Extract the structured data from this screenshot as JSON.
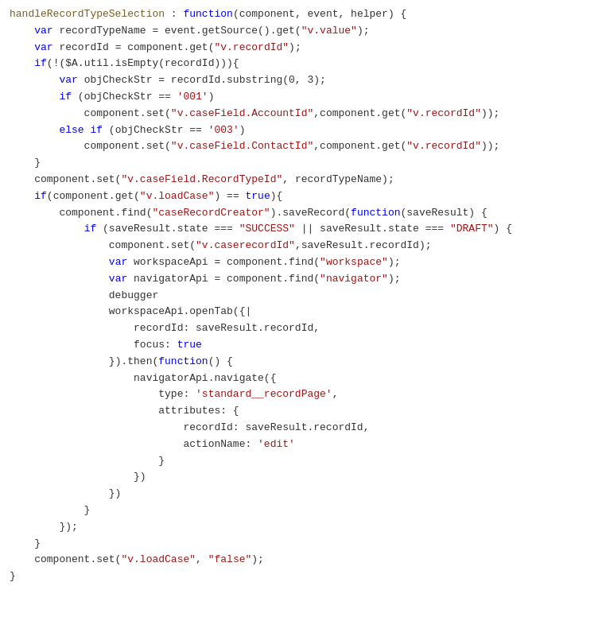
{
  "code": {
    "lines": [
      {
        "indent": 0,
        "tokens": [
          {
            "text": "handleRecordTypeSelection",
            "class": "c-fn-name"
          },
          {
            "text": " : ",
            "class": "c-default"
          },
          {
            "text": "function",
            "class": "c-keyword"
          },
          {
            "text": "(component, event, helper) {",
            "class": "c-default"
          }
        ]
      },
      {
        "indent": 1,
        "tokens": [
          {
            "text": "    ",
            "class": "c-default"
          },
          {
            "text": "var",
            "class": "c-keyword"
          },
          {
            "text": " recordTypeName = event.getSource().get(",
            "class": "c-default"
          },
          {
            "text": "\"v.value\"",
            "class": "c-string"
          },
          {
            "text": ");",
            "class": "c-default"
          }
        ]
      },
      {
        "indent": 1,
        "tokens": [
          {
            "text": "    ",
            "class": "c-default"
          },
          {
            "text": "var",
            "class": "c-keyword"
          },
          {
            "text": " recordId = component.get(",
            "class": "c-default"
          },
          {
            "text": "\"v.recordId\"",
            "class": "c-string"
          },
          {
            "text": ");",
            "class": "c-default"
          }
        ]
      },
      {
        "indent": 1,
        "tokens": [
          {
            "text": "    ",
            "class": "c-default"
          },
          {
            "text": "if",
            "class": "c-keyword"
          },
          {
            "text": "(!($A.util.isEmpty(recordId))){",
            "class": "c-default"
          }
        ]
      },
      {
        "indent": 2,
        "tokens": [
          {
            "text": "        ",
            "class": "c-default"
          },
          {
            "text": "var",
            "class": "c-keyword"
          },
          {
            "text": " objCheckStr = recordId.substring(0, 3);",
            "class": "c-default"
          }
        ]
      },
      {
        "indent": 2,
        "tokens": [
          {
            "text": "        ",
            "class": "c-default"
          },
          {
            "text": "if",
            "class": "c-keyword"
          },
          {
            "text": " (objCheckStr == ",
            "class": "c-default"
          },
          {
            "text": "'001'",
            "class": "c-string"
          },
          {
            "text": ")",
            "class": "c-default"
          }
        ]
      },
      {
        "indent": 3,
        "tokens": [
          {
            "text": "            component.set(",
            "class": "c-default"
          },
          {
            "text": "\"v.caseField.AccountId\"",
            "class": "c-string"
          },
          {
            "text": ",component.get(",
            "class": "c-default"
          },
          {
            "text": "\"v.recordId\"",
            "class": "c-string"
          },
          {
            "text": "));",
            "class": "c-default"
          }
        ]
      },
      {
        "indent": 2,
        "tokens": [
          {
            "text": "        ",
            "class": "c-default"
          },
          {
            "text": "else",
            "class": "c-keyword"
          },
          {
            "text": " ",
            "class": "c-default"
          },
          {
            "text": "if",
            "class": "c-keyword"
          },
          {
            "text": " (objCheckStr == ",
            "class": "c-default"
          },
          {
            "text": "'003'",
            "class": "c-string"
          },
          {
            "text": ")",
            "class": "c-default"
          }
        ]
      },
      {
        "indent": 3,
        "tokens": [
          {
            "text": "            component.set(",
            "class": "c-default"
          },
          {
            "text": "\"v.caseField.ContactId\"",
            "class": "c-string"
          },
          {
            "text": ",component.get(",
            "class": "c-default"
          },
          {
            "text": "\"v.recordId\"",
            "class": "c-string"
          },
          {
            "text": "));",
            "class": "c-default"
          }
        ]
      },
      {
        "indent": 1,
        "tokens": [
          {
            "text": "    }",
            "class": "c-default"
          }
        ]
      },
      {
        "indent": 1,
        "tokens": [
          {
            "text": "    component.set(",
            "class": "c-default"
          },
          {
            "text": "\"v.caseField.RecordTypeId\"",
            "class": "c-string"
          },
          {
            "text": ", recordTypeName);",
            "class": "c-default"
          }
        ]
      },
      {
        "indent": 1,
        "tokens": [
          {
            "text": "    ",
            "class": "c-default"
          },
          {
            "text": "if",
            "class": "c-keyword"
          },
          {
            "text": "(component.get(",
            "class": "c-default"
          },
          {
            "text": "\"v.loadCase\"",
            "class": "c-string"
          },
          {
            "text": ") == ",
            "class": "c-default"
          },
          {
            "text": "true",
            "class": "c-keyword"
          },
          {
            "text": "){",
            "class": "c-default"
          }
        ]
      },
      {
        "indent": 2,
        "tokens": [
          {
            "text": "        component.find(",
            "class": "c-default"
          },
          {
            "text": "\"caseRecordCreator\"",
            "class": "c-string"
          },
          {
            "text": ").saveRecord(",
            "class": "c-default"
          },
          {
            "text": "function",
            "class": "c-keyword"
          },
          {
            "text": "(saveResult) {",
            "class": "c-default"
          }
        ]
      },
      {
        "indent": 3,
        "tokens": [
          {
            "text": "            ",
            "class": "c-default"
          },
          {
            "text": "if",
            "class": "c-keyword"
          },
          {
            "text": " (saveResult.state === ",
            "class": "c-default"
          },
          {
            "text": "\"SUCCESS\"",
            "class": "c-string"
          },
          {
            "text": " || saveResult.state === ",
            "class": "c-default"
          },
          {
            "text": "\"DRAFT\"",
            "class": "c-string"
          },
          {
            "text": ") {",
            "class": "c-default"
          }
        ]
      },
      {
        "indent": 4,
        "tokens": [
          {
            "text": "                component.set(",
            "class": "c-default"
          },
          {
            "text": "\"v.caserecordId\"",
            "class": "c-string"
          },
          {
            "text": ",saveResult.recordId);",
            "class": "c-default"
          }
        ]
      },
      {
        "indent": 4,
        "tokens": [
          {
            "text": "                ",
            "class": "c-default"
          },
          {
            "text": "var",
            "class": "c-keyword"
          },
          {
            "text": " workspaceApi = component.find(",
            "class": "c-default"
          },
          {
            "text": "\"workspace\"",
            "class": "c-string"
          },
          {
            "text": ");",
            "class": "c-default"
          }
        ]
      },
      {
        "indent": 4,
        "tokens": [
          {
            "text": "                ",
            "class": "c-default"
          },
          {
            "text": "var",
            "class": "c-keyword"
          },
          {
            "text": " navigatorApi = component.find(",
            "class": "c-default"
          },
          {
            "text": "\"navigator\"",
            "class": "c-string"
          },
          {
            "text": ");",
            "class": "c-default"
          }
        ]
      },
      {
        "indent": 4,
        "tokens": [
          {
            "text": "                debugger",
            "class": "c-default"
          }
        ]
      },
      {
        "indent": 4,
        "tokens": [
          {
            "text": "                workspaceApi.openTab({",
            "class": "c-default"
          },
          {
            "text": "|",
            "class": "c-default"
          }
        ]
      },
      {
        "indent": 5,
        "tokens": [
          {
            "text": "                    recordId: saveResult.recordId,",
            "class": "c-default"
          }
        ]
      },
      {
        "indent": 5,
        "tokens": [
          {
            "text": "                    focus: ",
            "class": "c-default"
          },
          {
            "text": "true",
            "class": "c-keyword"
          }
        ]
      },
      {
        "indent": 4,
        "tokens": [
          {
            "text": "                ",
            "class": "c-default"
          },
          {
            "text": "}).then(",
            "class": "c-default"
          },
          {
            "text": "function",
            "class": "c-keyword"
          },
          {
            "text": "() {",
            "class": "c-default"
          }
        ]
      },
      {
        "indent": 5,
        "tokens": [
          {
            "text": "                    navigatorApi.navigate({",
            "class": "c-default"
          }
        ]
      },
      {
        "indent": 6,
        "tokens": [
          {
            "text": "                        type: ",
            "class": "c-default"
          },
          {
            "text": "'standard__recordPage'",
            "class": "c-string"
          },
          {
            "text": ",",
            "class": "c-default"
          }
        ]
      },
      {
        "indent": 6,
        "tokens": [
          {
            "text": "                        attributes: {",
            "class": "c-default"
          }
        ]
      },
      {
        "indent": 7,
        "tokens": [
          {
            "text": "                            recordId: saveResult.recordId,",
            "class": "c-default"
          }
        ]
      },
      {
        "indent": 7,
        "tokens": [
          {
            "text": "                            actionName: ",
            "class": "c-default"
          },
          {
            "text": "'edit'",
            "class": "c-string"
          }
        ]
      },
      {
        "indent": 6,
        "tokens": [
          {
            "text": "                        }",
            "class": "c-default"
          }
        ]
      },
      {
        "indent": 5,
        "tokens": [
          {
            "text": "                    })",
            "class": "c-default"
          }
        ]
      },
      {
        "indent": 4,
        "tokens": [
          {
            "text": "                })",
            "class": "c-default"
          }
        ]
      },
      {
        "indent": 3,
        "tokens": [
          {
            "text": "            }",
            "class": "c-default"
          }
        ]
      },
      {
        "indent": 2,
        "tokens": [
          {
            "text": "        });",
            "class": "c-default"
          }
        ]
      },
      {
        "indent": 1,
        "tokens": [
          {
            "text": "    }",
            "class": "c-default"
          }
        ]
      },
      {
        "indent": 1,
        "tokens": [
          {
            "text": "    component.set(",
            "class": "c-default"
          },
          {
            "text": "\"v.loadCase\"",
            "class": "c-string"
          },
          {
            "text": ", ",
            "class": "c-default"
          },
          {
            "text": "\"false\"",
            "class": "c-string"
          },
          {
            "text": ");",
            "class": "c-default"
          }
        ]
      },
      {
        "indent": 0,
        "tokens": [
          {
            "text": "}",
            "class": "c-default"
          }
        ]
      }
    ]
  }
}
